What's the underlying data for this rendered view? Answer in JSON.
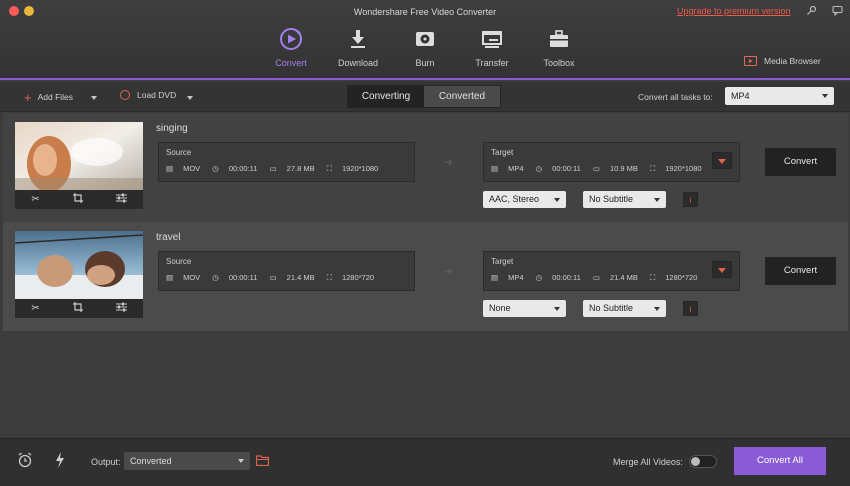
{
  "window": {
    "title": "Wondershare Free Video Converter",
    "upgrade_link": "Upgrade to premium version"
  },
  "nav": {
    "tabs": [
      {
        "label": "Convert",
        "icon": "convert-icon"
      },
      {
        "label": "Download",
        "icon": "download-icon"
      },
      {
        "label": "Burn",
        "icon": "burn-disc-icon"
      },
      {
        "label": "Transfer",
        "icon": "transfer-icon"
      },
      {
        "label": "Toolbox",
        "icon": "toolbox-icon"
      }
    ],
    "media_browser": "Media Browser"
  },
  "toolbar": {
    "add_files": "Add Files",
    "load_dvd": "Load DVD",
    "tab_converting": "Converting",
    "tab_converted": "Converted",
    "convert_all_label": "Convert all tasks to:",
    "convert_all_value": "MP4"
  },
  "tasks": [
    {
      "name": "singing",
      "source": {
        "label": "Source",
        "format": "MOV",
        "duration": "00:00:11",
        "size": "27.8 MB",
        "resolution": "1920*1080"
      },
      "target": {
        "label": "Target",
        "format": "MP4",
        "duration": "00:00:11",
        "size": "10.9 MB",
        "resolution": "1920*1080"
      },
      "audio": "AAC, Stereo",
      "subtitle": "No Subtitle",
      "convert_label": "Convert"
    },
    {
      "name": "travel",
      "source": {
        "label": "Source",
        "format": "MOV",
        "duration": "00:00:11",
        "size": "21.4 MB",
        "resolution": "1280*720"
      },
      "target": {
        "label": "Target",
        "format": "MP4",
        "duration": "00:00:11",
        "size": "21.4 MB",
        "resolution": "1280*720"
      },
      "audio": "None",
      "subtitle": "No Subtitle",
      "convert_label": "Convert"
    }
  ],
  "footer": {
    "output_label": "Output:",
    "output_value": "Converted",
    "merge_label": "Merge All Videos:",
    "merge_on": false,
    "convert_all_button": "Convert All"
  },
  "colors": {
    "accent": "#8a5bd6",
    "highlight": "#e0624f",
    "upgrade": "#f05a4a"
  }
}
